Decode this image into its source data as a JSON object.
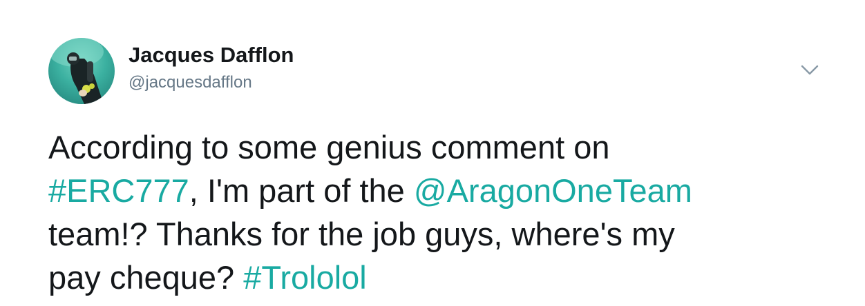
{
  "author": {
    "display_name": "Jacques Dafflon",
    "handle": "@jacquesdafflon",
    "avatar_icon": "scuba-diver-avatar"
  },
  "menu": {
    "icon": "chevron-down-icon"
  },
  "tweet": {
    "line1": "According to some genius comment on",
    "hashtag1": "#ERC777",
    "line2_mid": ", I'm part of the ",
    "mention": "@AragonOneTeam",
    "line3": "team!? Thanks for the job guys, where's my",
    "line4_start": "pay cheque? ",
    "hashtag2": "#Trololol"
  },
  "colors": {
    "link": "#19aaa2",
    "text": "#14171a",
    "secondary": "#657786"
  }
}
